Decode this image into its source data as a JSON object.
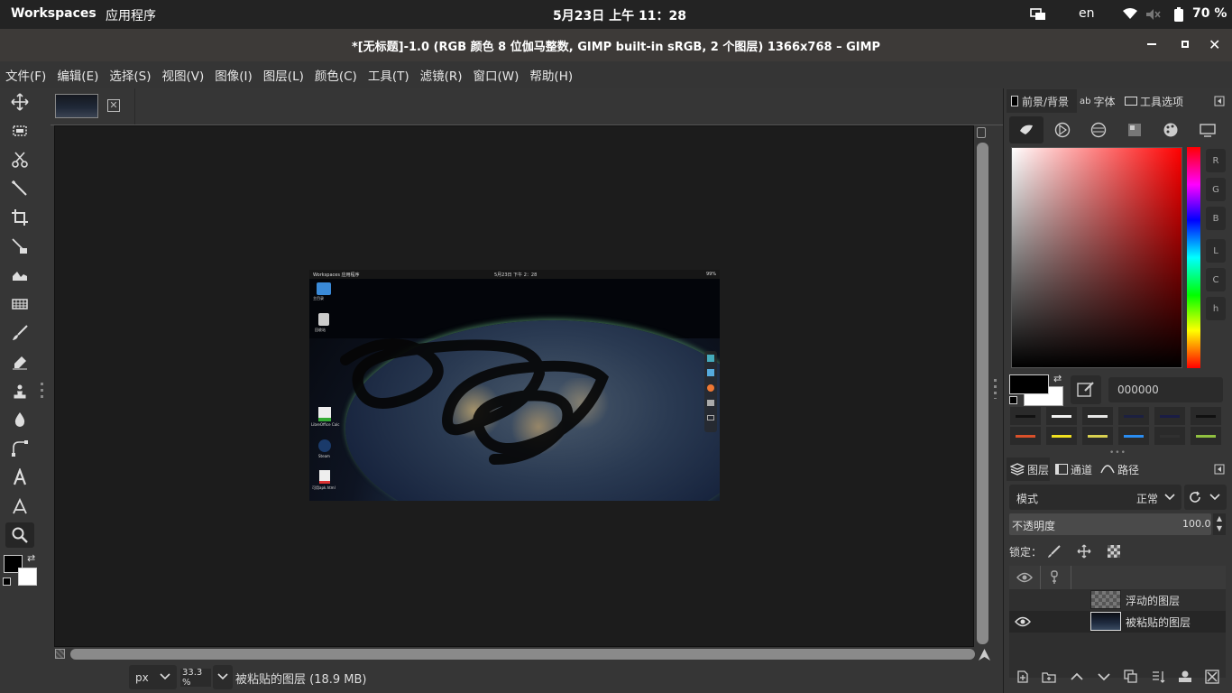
{
  "topbar": {
    "workspaces": "Workspaces",
    "apps": "应用程序",
    "clock": "5月23日  上午 11：28",
    "lang": "en",
    "battery": "70 %"
  },
  "window": {
    "title": "*[无标题]-1.0 (RGB 颜色 8 位伽马整数, GIMP built-in sRGB, 2 个图层) 1366x768 – GIMP"
  },
  "menu": [
    "文件(F)",
    "编辑(E)",
    "选择(S)",
    "视图(V)",
    "图像(I)",
    "图层(L)",
    "颜色(C)",
    "工具(T)",
    "滤镜(R)",
    "窗口(W)",
    "帮助(H)"
  ],
  "thumb_desktop": {
    "bar_left": "Workspaces   应用程序",
    "bar_center": "5月23日  下午 2：28",
    "bar_right": "99%",
    "icons": [
      "主目录",
      "回收站",
      "LibreOffice Calc",
      "Steam",
      "可用apk.html"
    ]
  },
  "statusbar": {
    "unit": "px",
    "zoom": "33.3 %",
    "layer_info": "被粘贴的图层 (18.9 MB)"
  },
  "color_panel": {
    "tabs": [
      "前景/背景",
      "字体",
      "工具选项"
    ],
    "channels": [
      "R",
      "G",
      "B",
      "L",
      "C",
      "h"
    ],
    "hex": "000000",
    "swatches": [
      "#111111",
      "#f2f2f2",
      "#e6e6e6",
      "#1c2040",
      "#1a1d45",
      "#101010",
      "#d9502a",
      "#f0e020",
      "#d8d050",
      "#2a8cf0",
      "#303030",
      "#90c040"
    ]
  },
  "layers_panel": {
    "tabs": [
      "图层",
      "通道",
      "路径"
    ],
    "mode_label": "模式",
    "mode_value": "正常",
    "opacity_label": "不透明度",
    "opacity_value": "100.0",
    "lock_label": "锁定：",
    "layers": [
      {
        "name": "浮动的图层"
      },
      {
        "name": "被粘贴的图层"
      }
    ]
  }
}
